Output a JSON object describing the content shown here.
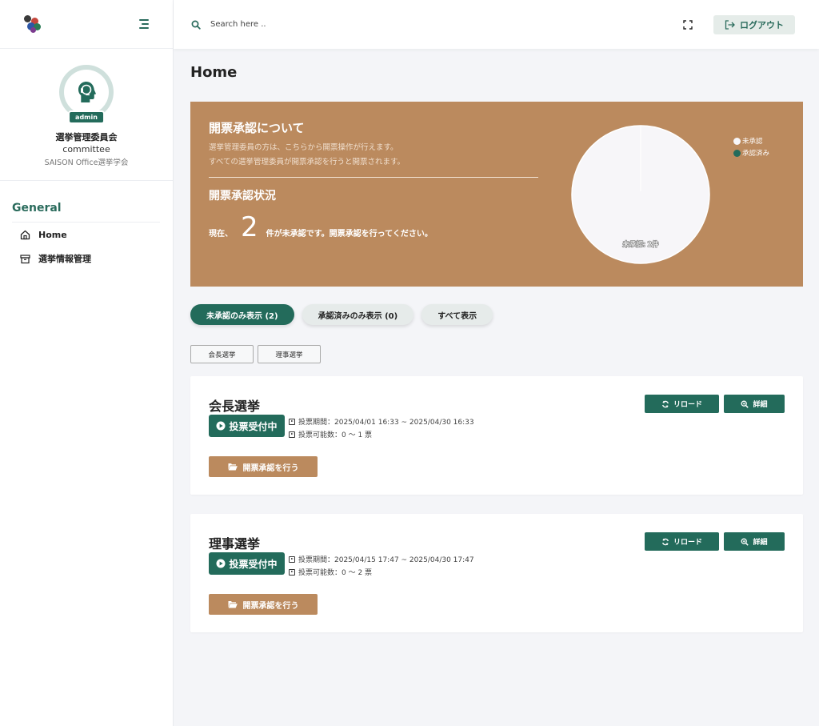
{
  "header": {
    "search_placeholder": "Search here ..",
    "logout_label": "ログアウト"
  },
  "profile": {
    "badge": "admin",
    "name": "選挙管理委員会",
    "role": "committee",
    "org": "SAISON Office選挙学会"
  },
  "sidebar": {
    "section_title": "General",
    "items": [
      {
        "label": "Home",
        "icon": "home-icon"
      },
      {
        "label": "選挙情報管理",
        "icon": "archive-icon"
      }
    ]
  },
  "page": {
    "title": "Home"
  },
  "banner": {
    "heading": "開票承認について",
    "line1": "選挙管理委員の方は、こちらから開票操作が行えます。",
    "line2": "すべての選挙管理委員が開票承認を行うと開票されます。",
    "status_heading": "開票承認状況",
    "status_prefix": "現在、",
    "status_count": "2",
    "status_suffix": "件が未承認です。開票承認を行ってください。"
  },
  "chart_data": {
    "type": "pie",
    "categories": [
      "未承認",
      "承認済み"
    ],
    "values": [
      2,
      0
    ],
    "slice_label": "未承認: 2件",
    "legend_position": "top-right",
    "colors": [
      "#f7f6f9",
      "#236b5b"
    ]
  },
  "filters": [
    {
      "label": "未承認のみ表示 (2)",
      "active": true
    },
    {
      "label": "承認済みのみ表示 (0)",
      "active": false
    },
    {
      "label": "すべて表示",
      "active": false
    }
  ],
  "tags": [
    "会長選挙",
    "理事選挙"
  ],
  "elections": [
    {
      "title": "会長選挙",
      "status": "投票受付中",
      "period": "投票期間：2025/04/01 16:33 ~ 2025/04/30 16:33",
      "votes": "投票可能数：0 〜 1 票",
      "reload_label": "リロード",
      "detail_label": "詳細",
      "open_label": "開票承認を行う"
    },
    {
      "title": "理事選挙",
      "status": "投票受付中",
      "period": "投票期間：2025/04/15 17:47 ~ 2025/04/30 17:47",
      "votes": "投票可能数：0 〜 2 票",
      "reload_label": "リロード",
      "detail_label": "詳細",
      "open_label": "開票承認を行う"
    }
  ],
  "colors": {
    "primary": "#236b5b",
    "accent_brown": "#bb8a5e",
    "background": "#f4f5f8"
  }
}
